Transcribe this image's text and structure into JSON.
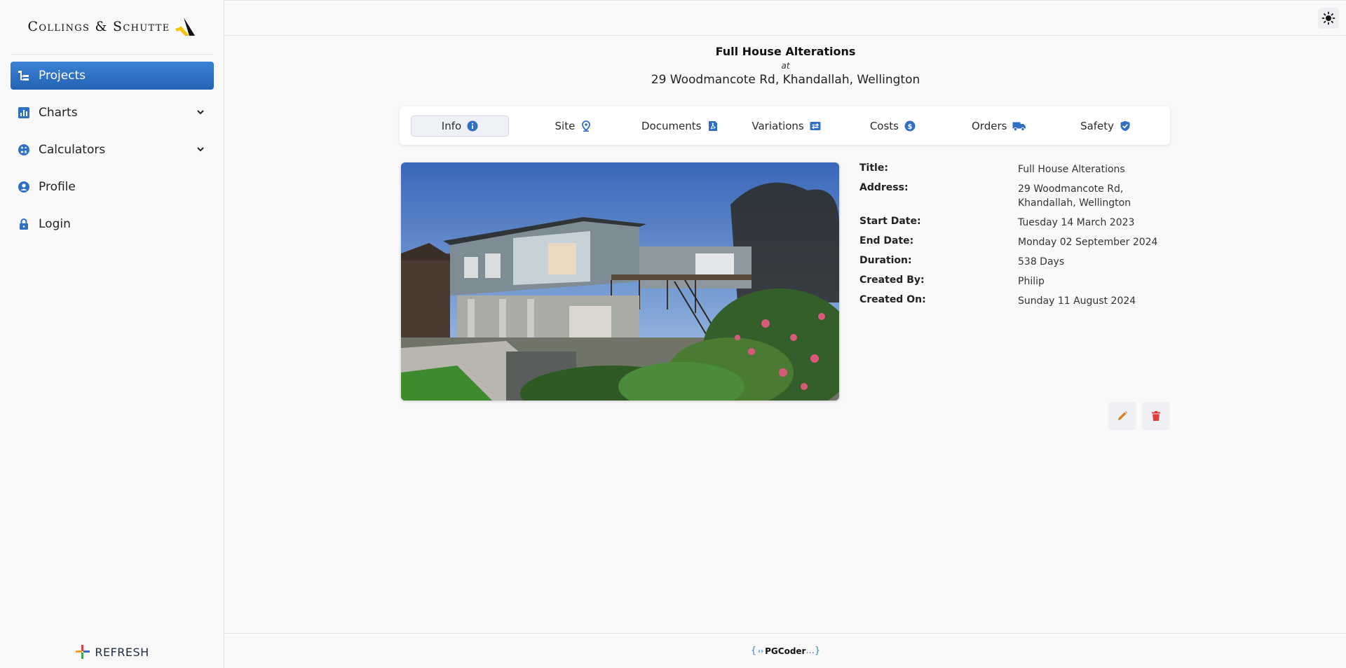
{
  "brand": {
    "name": "Collings & Schutte"
  },
  "nav": {
    "items": [
      {
        "label": "Projects",
        "icon": "projects-tree-icon",
        "active": true
      },
      {
        "label": "Charts",
        "icon": "chart-icon",
        "expandable": true
      },
      {
        "label": "Calculators",
        "icon": "calculator-icon",
        "expandable": true
      },
      {
        "label": "Profile",
        "icon": "user-icon"
      },
      {
        "label": "Login",
        "icon": "lock-icon"
      }
    ]
  },
  "sidebar_footer": {
    "label": "REFRESH"
  },
  "project": {
    "title": "Full House Alterations",
    "at": "at",
    "address": "29 Woodmancote Rd, Khandallah, Wellington"
  },
  "tabs": [
    {
      "label": "Info",
      "icon": "info-icon",
      "active": true
    },
    {
      "label": "Site",
      "icon": "map-pin-icon"
    },
    {
      "label": "Documents",
      "icon": "pdf-icon"
    },
    {
      "label": "Variations",
      "icon": "swap-icon"
    },
    {
      "label": "Costs",
      "icon": "dollar-icon"
    },
    {
      "label": "Orders",
      "icon": "truck-icon"
    },
    {
      "label": "Safety",
      "icon": "shield-check-icon"
    }
  ],
  "details": [
    {
      "label": "Title:",
      "value": "Full House Alterations"
    },
    {
      "label": "Address:",
      "value": "29 Woodmancote Rd, Khandallah, Wellington"
    },
    {
      "label": "Start Date:",
      "value": "Tuesday 14 March 2023"
    },
    {
      "label": "End Date:",
      "value": "Monday 02 September 2024"
    },
    {
      "label": "Duration:",
      "value": "538 Days"
    },
    {
      "label": "Created By:",
      "value": "Philip"
    },
    {
      "label": "Created On:",
      "value": "Sunday 11 August 2024"
    }
  ],
  "footer": {
    "open": "{",
    "brand": "PGCoder",
    "close": "...}"
  },
  "colors": {
    "primary": "#2f6fc4",
    "edit": "#e07b22",
    "delete": "#e23b3b"
  }
}
